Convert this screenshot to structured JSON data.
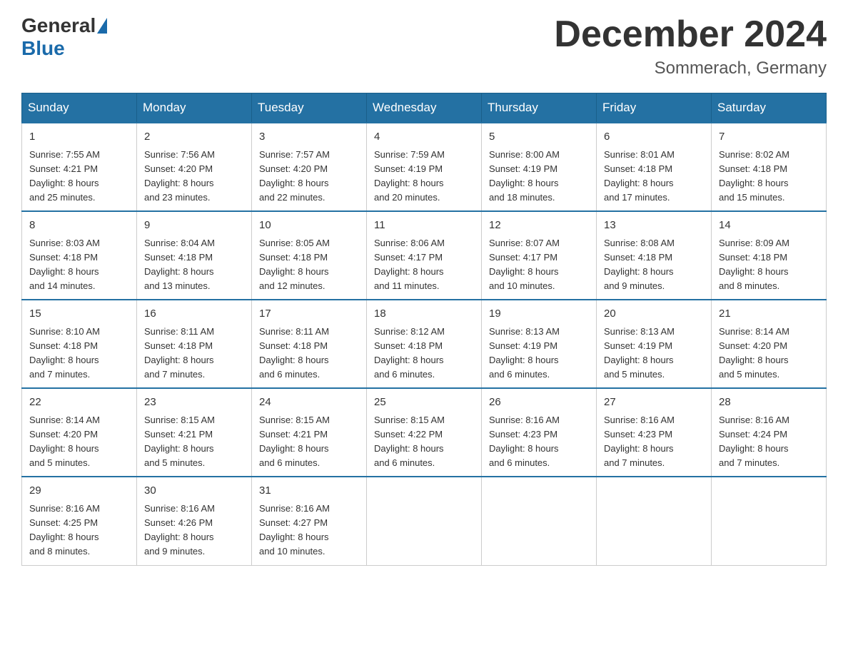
{
  "header": {
    "logo_general": "General",
    "logo_blue": "Blue",
    "month_title": "December 2024",
    "location": "Sommerach, Germany"
  },
  "weekdays": [
    "Sunday",
    "Monday",
    "Tuesday",
    "Wednesday",
    "Thursday",
    "Friday",
    "Saturday"
  ],
  "weeks": [
    [
      {
        "day": "1",
        "sunrise": "7:55 AM",
        "sunset": "4:21 PM",
        "daylight": "8 hours and 25 minutes."
      },
      {
        "day": "2",
        "sunrise": "7:56 AM",
        "sunset": "4:20 PM",
        "daylight": "8 hours and 23 minutes."
      },
      {
        "day": "3",
        "sunrise": "7:57 AM",
        "sunset": "4:20 PM",
        "daylight": "8 hours and 22 minutes."
      },
      {
        "day": "4",
        "sunrise": "7:59 AM",
        "sunset": "4:19 PM",
        "daylight": "8 hours and 20 minutes."
      },
      {
        "day": "5",
        "sunrise": "8:00 AM",
        "sunset": "4:19 PM",
        "daylight": "8 hours and 18 minutes."
      },
      {
        "day": "6",
        "sunrise": "8:01 AM",
        "sunset": "4:18 PM",
        "daylight": "8 hours and 17 minutes."
      },
      {
        "day": "7",
        "sunrise": "8:02 AM",
        "sunset": "4:18 PM",
        "daylight": "8 hours and 15 minutes."
      }
    ],
    [
      {
        "day": "8",
        "sunrise": "8:03 AM",
        "sunset": "4:18 PM",
        "daylight": "8 hours and 14 minutes."
      },
      {
        "day": "9",
        "sunrise": "8:04 AM",
        "sunset": "4:18 PM",
        "daylight": "8 hours and 13 minutes."
      },
      {
        "day": "10",
        "sunrise": "8:05 AM",
        "sunset": "4:18 PM",
        "daylight": "8 hours and 12 minutes."
      },
      {
        "day": "11",
        "sunrise": "8:06 AM",
        "sunset": "4:17 PM",
        "daylight": "8 hours and 11 minutes."
      },
      {
        "day": "12",
        "sunrise": "8:07 AM",
        "sunset": "4:17 PM",
        "daylight": "8 hours and 10 minutes."
      },
      {
        "day": "13",
        "sunrise": "8:08 AM",
        "sunset": "4:18 PM",
        "daylight": "8 hours and 9 minutes."
      },
      {
        "day": "14",
        "sunrise": "8:09 AM",
        "sunset": "4:18 PM",
        "daylight": "8 hours and 8 minutes."
      }
    ],
    [
      {
        "day": "15",
        "sunrise": "8:10 AM",
        "sunset": "4:18 PM",
        "daylight": "8 hours and 7 minutes."
      },
      {
        "day": "16",
        "sunrise": "8:11 AM",
        "sunset": "4:18 PM",
        "daylight": "8 hours and 7 minutes."
      },
      {
        "day": "17",
        "sunrise": "8:11 AM",
        "sunset": "4:18 PM",
        "daylight": "8 hours and 6 minutes."
      },
      {
        "day": "18",
        "sunrise": "8:12 AM",
        "sunset": "4:18 PM",
        "daylight": "8 hours and 6 minutes."
      },
      {
        "day": "19",
        "sunrise": "8:13 AM",
        "sunset": "4:19 PM",
        "daylight": "8 hours and 6 minutes."
      },
      {
        "day": "20",
        "sunrise": "8:13 AM",
        "sunset": "4:19 PM",
        "daylight": "8 hours and 5 minutes."
      },
      {
        "day": "21",
        "sunrise": "8:14 AM",
        "sunset": "4:20 PM",
        "daylight": "8 hours and 5 minutes."
      }
    ],
    [
      {
        "day": "22",
        "sunrise": "8:14 AM",
        "sunset": "4:20 PM",
        "daylight": "8 hours and 5 minutes."
      },
      {
        "day": "23",
        "sunrise": "8:15 AM",
        "sunset": "4:21 PM",
        "daylight": "8 hours and 5 minutes."
      },
      {
        "day": "24",
        "sunrise": "8:15 AM",
        "sunset": "4:21 PM",
        "daylight": "8 hours and 6 minutes."
      },
      {
        "day": "25",
        "sunrise": "8:15 AM",
        "sunset": "4:22 PM",
        "daylight": "8 hours and 6 minutes."
      },
      {
        "day": "26",
        "sunrise": "8:16 AM",
        "sunset": "4:23 PM",
        "daylight": "8 hours and 6 minutes."
      },
      {
        "day": "27",
        "sunrise": "8:16 AM",
        "sunset": "4:23 PM",
        "daylight": "8 hours and 7 minutes."
      },
      {
        "day": "28",
        "sunrise": "8:16 AM",
        "sunset": "4:24 PM",
        "daylight": "8 hours and 7 minutes."
      }
    ],
    [
      {
        "day": "29",
        "sunrise": "8:16 AM",
        "sunset": "4:25 PM",
        "daylight": "8 hours and 8 minutes."
      },
      {
        "day": "30",
        "sunrise": "8:16 AM",
        "sunset": "4:26 PM",
        "daylight": "8 hours and 9 minutes."
      },
      {
        "day": "31",
        "sunrise": "8:16 AM",
        "sunset": "4:27 PM",
        "daylight": "8 hours and 10 minutes."
      },
      null,
      null,
      null,
      null
    ]
  ],
  "labels": {
    "sunrise": "Sunrise:",
    "sunset": "Sunset:",
    "daylight": "Daylight:"
  }
}
